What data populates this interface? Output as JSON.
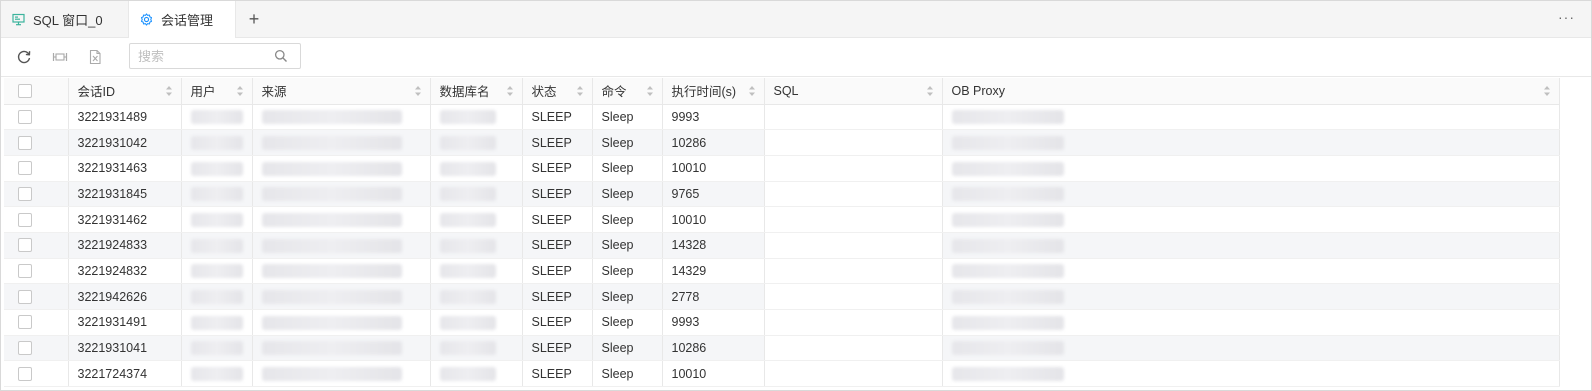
{
  "tabs": [
    {
      "label": "SQL 窗口_0",
      "icon": "sql-window-icon"
    },
    {
      "label": "会话管理",
      "icon": "gear-icon"
    }
  ],
  "add_tab": "+",
  "more": "···",
  "toolbar": {
    "refresh_icon": "refresh-icon",
    "close_session_icon": "close-session-icon",
    "kill_query_icon": "kill-query-icon",
    "search_placeholder": "搜索"
  },
  "table": {
    "columns": [
      "会话ID",
      "用户",
      "来源",
      "数据库名",
      "状态",
      "命令",
      "执行时间(s)",
      "SQL",
      "OB Proxy"
    ],
    "rows": [
      {
        "id": "3221931489",
        "status": "SLEEP",
        "command": "Sleep",
        "time": "9993"
      },
      {
        "id": "3221931042",
        "status": "SLEEP",
        "command": "Sleep",
        "time": "10286"
      },
      {
        "id": "3221931463",
        "status": "SLEEP",
        "command": "Sleep",
        "time": "10010"
      },
      {
        "id": "3221931845",
        "status": "SLEEP",
        "command": "Sleep",
        "time": "9765"
      },
      {
        "id": "3221931462",
        "status": "SLEEP",
        "command": "Sleep",
        "time": "10010"
      },
      {
        "id": "3221924833",
        "status": "SLEEP",
        "command": "Sleep",
        "time": "14328"
      },
      {
        "id": "3221924832",
        "status": "SLEEP",
        "command": "Sleep",
        "time": "14329"
      },
      {
        "id": "3221942626",
        "status": "SLEEP",
        "command": "Sleep",
        "time": "2778"
      },
      {
        "id": "3221931491",
        "status": "SLEEP",
        "command": "Sleep",
        "time": "9993"
      },
      {
        "id": "3221931041",
        "status": "SLEEP",
        "command": "Sleep",
        "time": "10286"
      },
      {
        "id": "3221724374",
        "status": "SLEEP",
        "command": "Sleep",
        "time": "10010"
      }
    ]
  },
  "colors": {
    "accent": "#1890ff",
    "sql_icon": "#3bb39c",
    "alt_row": "#f5f6f8"
  }
}
